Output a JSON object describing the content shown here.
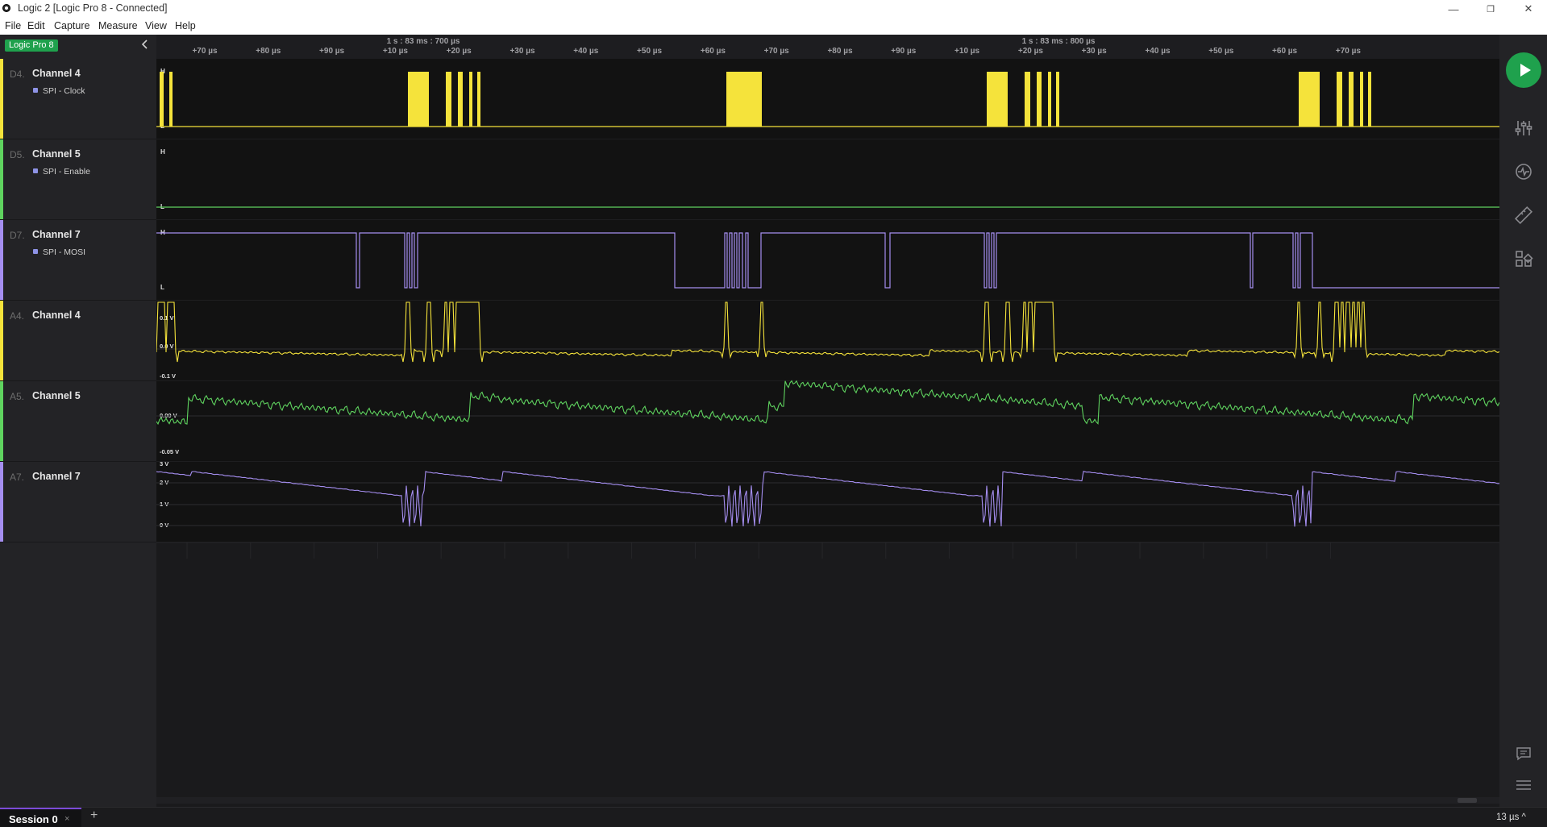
{
  "window": {
    "title": "Logic 2 [Logic Pro 8 - Connected]",
    "controls": [
      "—",
      "❐",
      "✕"
    ]
  },
  "menu": [
    "File",
    "Edit",
    "Capture",
    "Measure",
    "View",
    "Help"
  ],
  "device_badge": "Logic Pro 8",
  "channels": [
    {
      "id": "D4.",
      "name": "Channel 4",
      "sub": "SPI - Clock",
      "color": "#f5e33b",
      "type": "digital"
    },
    {
      "id": "D5.",
      "name": "Channel 5",
      "sub": "SPI - Enable",
      "color": "#5fd35f",
      "type": "digital"
    },
    {
      "id": "D7.",
      "name": "Channel 7",
      "sub": "SPI - MOSI",
      "color": "#a58ef0",
      "type": "digital"
    },
    {
      "id": "A4.",
      "name": "Channel 4",
      "sub": "",
      "color": "#f5e33b",
      "type": "analog"
    },
    {
      "id": "A5.",
      "name": "Channel 5",
      "sub": "",
      "color": "#5fd35f",
      "type": "analog"
    },
    {
      "id": "A7.",
      "name": "Channel 7",
      "sub": "",
      "color": "#a58ef0",
      "type": "analog"
    }
  ],
  "time_axis": {
    "major_labels": [
      "1 s : 83 ms : 700 µs",
      "1 s : 83 ms : 800 µs"
    ],
    "ticks": [
      "+70 µs",
      "+80 µs",
      "+90 µs",
      "+10 µs",
      "+20 µs",
      "+30 µs",
      "+40 µs",
      "+50 µs",
      "+60 µs",
      "+70 µs",
      "+80 µs",
      "+90 µs",
      "+10 µs",
      "+20 µs",
      "+30 µs",
      "+40 µs",
      "+50 µs",
      "+60 µs",
      "+70 µs"
    ]
  },
  "digital_level_labels": {
    "high": "H",
    "low": "L"
  },
  "analog_scales": {
    "a4": [
      "0.1 V",
      "0.0 V",
      "-0.1 V"
    ],
    "a5": [
      "0.00 V",
      "-0.05 V"
    ],
    "a7": [
      "3 V",
      "2 V",
      "1 V",
      "0 V"
    ]
  },
  "rail_icons": [
    "play-icon",
    "sliders-icon",
    "analyzer-icon",
    "ruler-icon",
    "extensions-icon",
    "feedback-icon",
    "menu-icon"
  ],
  "status": {
    "session": "Session 0",
    "close": "×",
    "add": "+",
    "zoom": "13 µs ^"
  }
}
